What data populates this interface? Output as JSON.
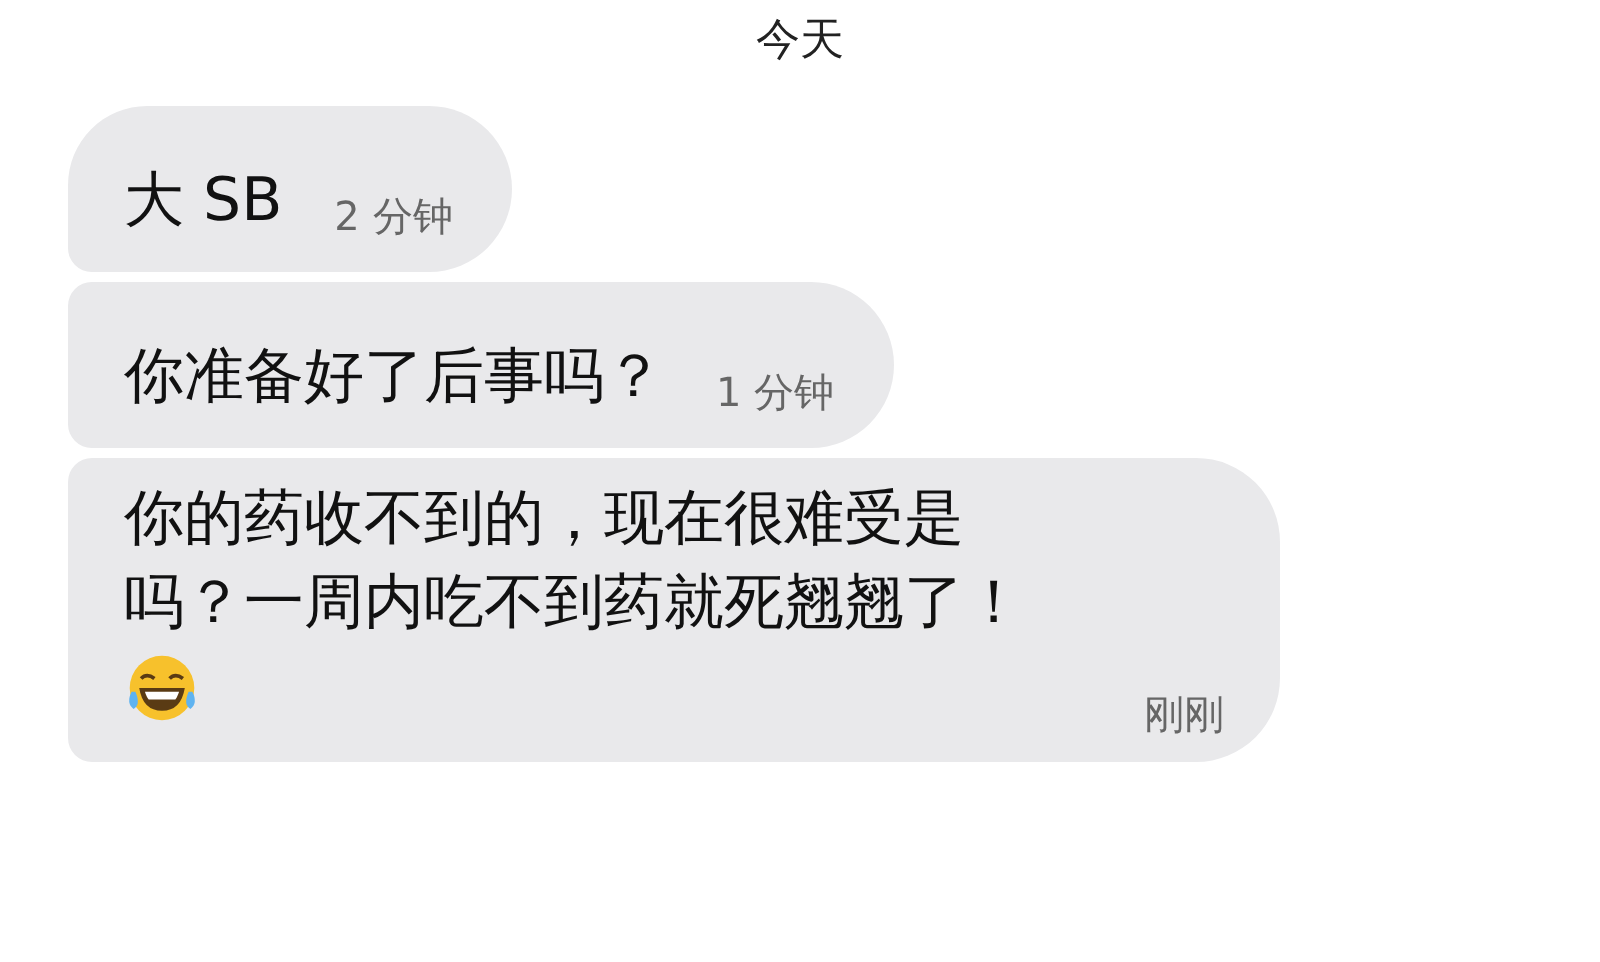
{
  "date_divider": "今天",
  "messages": [
    {
      "kind": "inline",
      "text": "大 SB",
      "time": "2 分钟",
      "emoji": false
    },
    {
      "kind": "inline",
      "text": "你准备好了后事吗？",
      "time": "1 分钟",
      "emoji": false
    },
    {
      "kind": "block",
      "lines": [
        "你的药收不到的，现在很难受是",
        "吗？一周内吃不到药就死翘翘了！"
      ],
      "time": "刚刚",
      "emoji": true
    }
  ]
}
